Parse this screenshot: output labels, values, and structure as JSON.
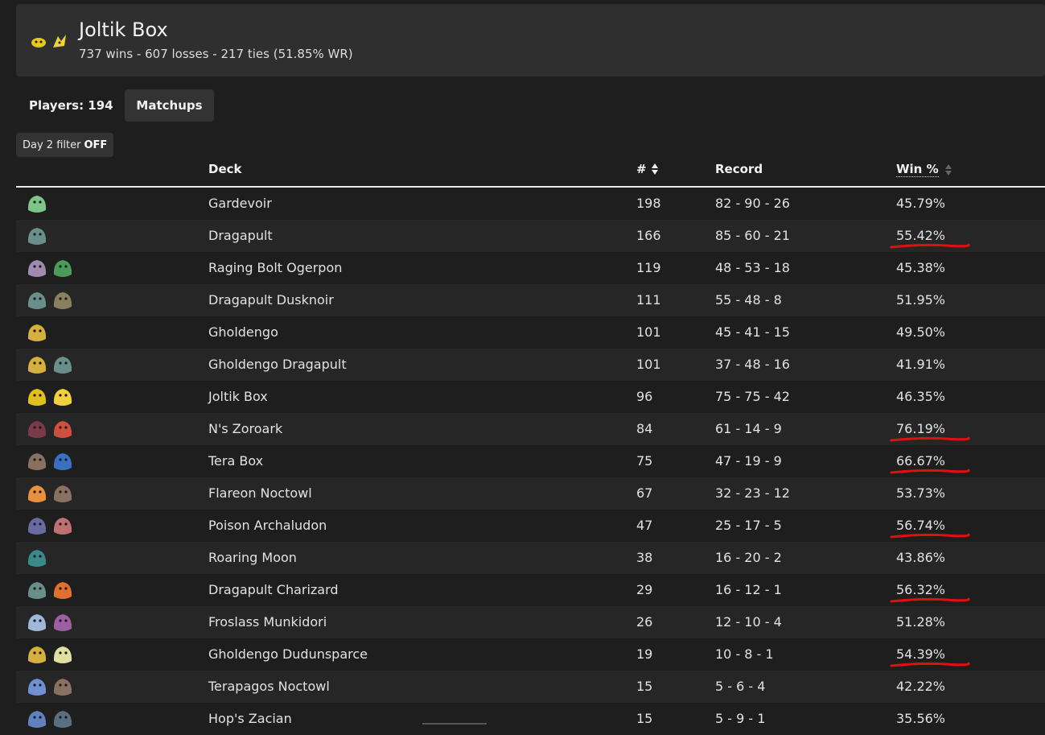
{
  "header": {
    "title": "Joltik Box",
    "subtitle": "737 wins - 607 losses - 217 ties (51.85% WR)"
  },
  "players_label": "Players: 194",
  "matchups_label": "Matchups",
  "filter": {
    "label": "Day 2 filter",
    "state": "OFF"
  },
  "columns": {
    "deck": "Deck",
    "count": "#",
    "record": "Record",
    "win": "Win %"
  },
  "rows": [
    {
      "deck": "Gardevoir",
      "count": "198",
      "record": "82 - 90 - 26",
      "win": "45.79%",
      "highlight": false,
      "icons": [
        "gardevoir-icon"
      ]
    },
    {
      "deck": "Dragapult",
      "count": "166",
      "record": "85 - 60 - 21",
      "win": "55.42%",
      "highlight": true,
      "icons": [
        "dragapult-icon"
      ]
    },
    {
      "deck": "Raging Bolt Ogerpon",
      "count": "119",
      "record": "48 - 53 - 18",
      "win": "45.38%",
      "highlight": false,
      "icons": [
        "raging-bolt-icon",
        "ogerpon-icon"
      ]
    },
    {
      "deck": "Dragapult Dusknoir",
      "count": "111",
      "record": "55 - 48 - 8",
      "win": "51.95%",
      "highlight": false,
      "icons": [
        "dragapult-icon",
        "dusknoir-icon"
      ]
    },
    {
      "deck": "Gholdengo",
      "count": "101",
      "record": "45 - 41 - 15",
      "win": "49.50%",
      "highlight": false,
      "icons": [
        "gholdengo-icon"
      ]
    },
    {
      "deck": "Gholdengo Dragapult",
      "count": "101",
      "record": "37 - 48 - 16",
      "win": "41.91%",
      "highlight": false,
      "icons": [
        "gholdengo-icon",
        "dragapult-icon"
      ]
    },
    {
      "deck": "Joltik Box",
      "count": "96",
      "record": "75 - 75 - 42",
      "win": "46.35%",
      "highlight": false,
      "icons": [
        "joltik-icon",
        "pikachu-icon"
      ]
    },
    {
      "deck": "N's Zoroark",
      "count": "84",
      "record": "61 - 14 - 9",
      "win": "76.19%",
      "highlight": true,
      "icons": [
        "zoroark-icon",
        "darmanitan-icon"
      ]
    },
    {
      "deck": "Tera Box",
      "count": "75",
      "record": "47 - 19 - 9",
      "win": "66.67%",
      "highlight": true,
      "icons": [
        "noctowl-icon",
        "tera-icon"
      ]
    },
    {
      "deck": "Flareon Noctowl",
      "count": "67",
      "record": "32 - 23 - 12",
      "win": "53.73%",
      "highlight": false,
      "icons": [
        "flareon-icon",
        "noctowl-icon"
      ]
    },
    {
      "deck": "Poison Archaludon",
      "count": "47",
      "record": "25 - 17 - 5",
      "win": "56.74%",
      "highlight": true,
      "icons": [
        "archaludon-icon",
        "poison-icon"
      ]
    },
    {
      "deck": "Roaring Moon",
      "count": "38",
      "record": "16 - 20 - 2",
      "win": "43.86%",
      "highlight": false,
      "icons": [
        "roaring-moon-icon"
      ]
    },
    {
      "deck": "Dragapult Charizard",
      "count": "29",
      "record": "16 - 12 - 1",
      "win": "56.32%",
      "highlight": true,
      "icons": [
        "dragapult-icon",
        "charizard-icon"
      ]
    },
    {
      "deck": "Froslass Munkidori",
      "count": "26",
      "record": "12 - 10 - 4",
      "win": "51.28%",
      "highlight": false,
      "icons": [
        "froslass-icon",
        "munkidori-icon"
      ]
    },
    {
      "deck": "Gholdengo Dudunsparce",
      "count": "19",
      "record": "10 - 8 - 1",
      "win": "54.39%",
      "highlight": true,
      "icons": [
        "gholdengo-icon",
        "dudunsparce-icon"
      ]
    },
    {
      "deck": "Terapagos Noctowl",
      "count": "15",
      "record": "5 - 6 - 4",
      "win": "42.22%",
      "highlight": false,
      "icons": [
        "terapagos-icon",
        "noctowl-icon"
      ]
    },
    {
      "deck": "Hop's Zacian",
      "count": "15",
      "record": "5 - 9 - 1",
      "win": "35.56%",
      "highlight": false,
      "icons": [
        "zacian-icon",
        "snorlax-icon"
      ]
    }
  ],
  "icon_colors": {
    "gardevoir-icon": "#7cc48a",
    "dragapult-icon": "#6a8f8a",
    "raging-bolt-icon": "#a08ab0",
    "ogerpon-icon": "#4a9a5a",
    "dusknoir-icon": "#8a8060",
    "gholdengo-icon": "#d4b040",
    "joltik-icon": "#e0c020",
    "pikachu-icon": "#f0d040",
    "zoroark-icon": "#7a3a4a",
    "darmanitan-icon": "#d05040",
    "noctowl-icon": "#8a7060",
    "tera-icon": "#3a70c0",
    "flareon-icon": "#e89040",
    "archaludon-icon": "#6a6aa0",
    "poison-icon": "#c07070",
    "roaring-moon-icon": "#3a8a8a",
    "charizard-icon": "#e07030",
    "froslass-icon": "#a0b8d8",
    "munkidori-icon": "#9a60a0",
    "dudunsparce-icon": "#e0e0a0",
    "terapagos-icon": "#7090d0",
    "zacian-icon": "#6080c0",
    "snorlax-icon": "#5a7080"
  },
  "highlight_color": "#e01010"
}
